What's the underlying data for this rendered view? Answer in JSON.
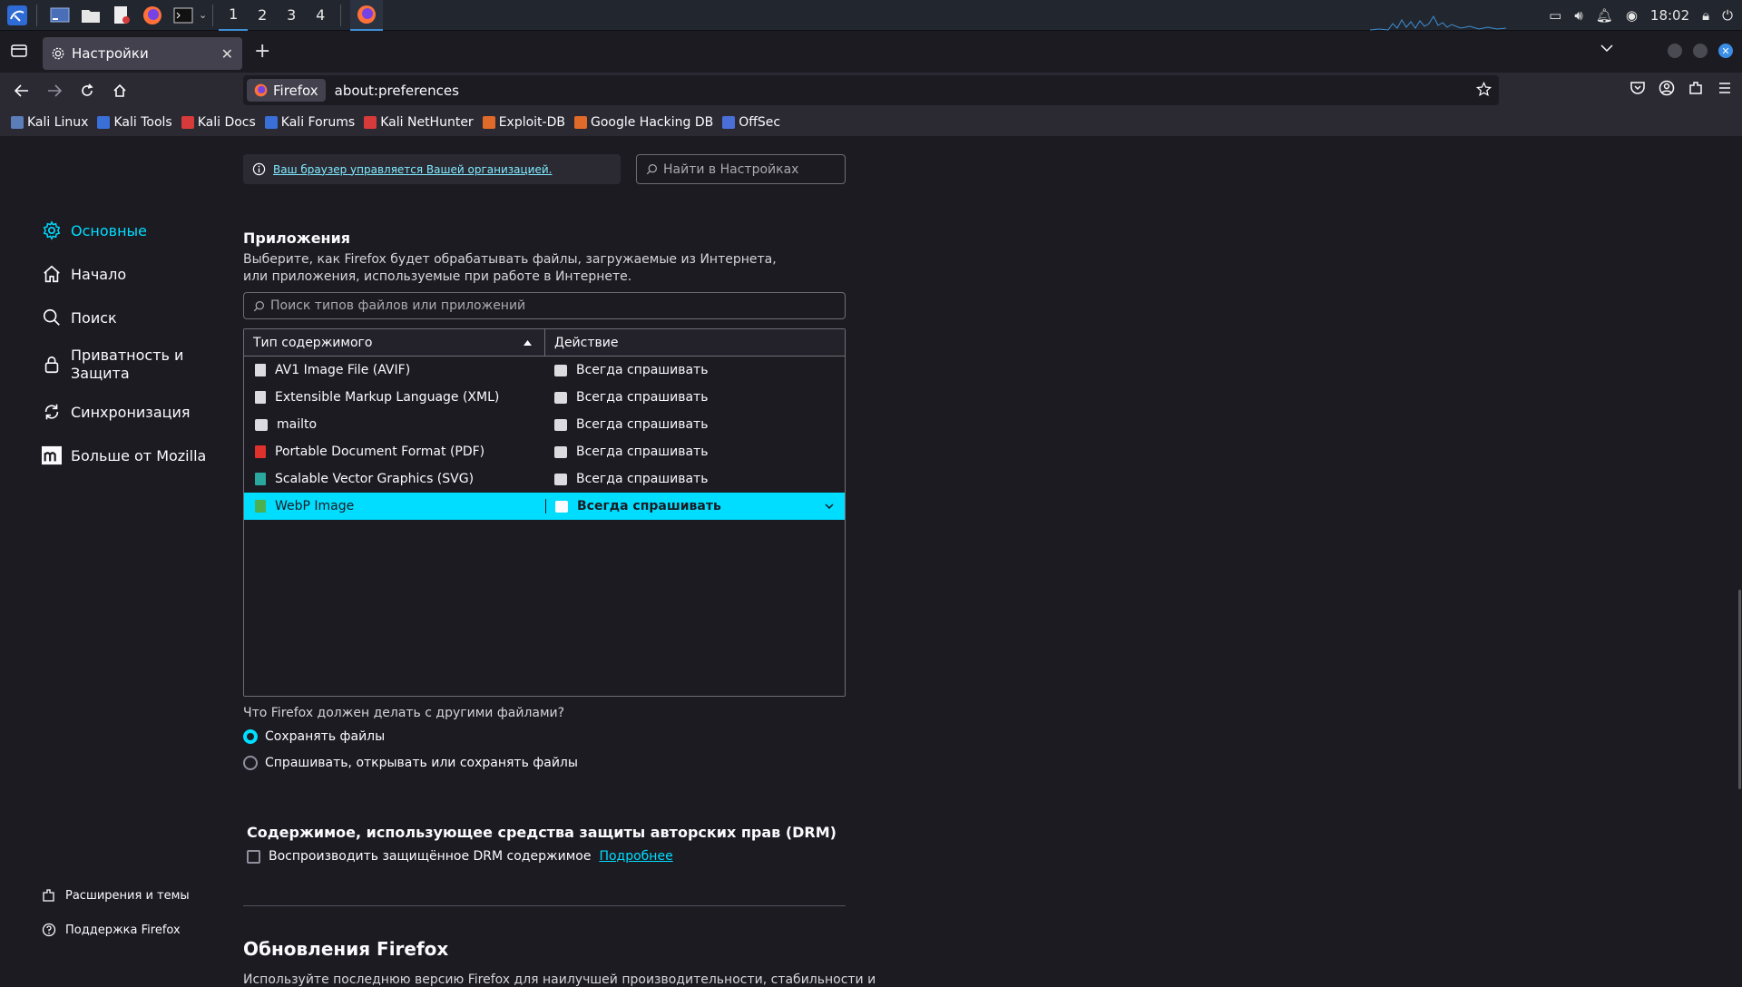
{
  "taskbar": {
    "workspaces": [
      "1",
      "2",
      "3",
      "4"
    ],
    "clock": "18:02"
  },
  "tab": {
    "title": "Настройки"
  },
  "navbar": {
    "identity": "Firefox",
    "url": "about:preferences"
  },
  "bookmarks": [
    {
      "label": "Kali Linux",
      "color": "#5b7db8"
    },
    {
      "label": "Kali Tools",
      "color": "#3a6fd8"
    },
    {
      "label": "Kali Docs",
      "color": "#d63a3a"
    },
    {
      "label": "Kali Forums",
      "color": "#3a6fd8"
    },
    {
      "label": "Kali NetHunter",
      "color": "#d63a3a"
    },
    {
      "label": "Exploit-DB",
      "color": "#e06a2a"
    },
    {
      "label": "Google Hacking DB",
      "color": "#e06a2a"
    },
    {
      "label": "OffSec",
      "color": "#4a6fd8"
    }
  ],
  "content": {
    "managed_notice": "Ваш браузер управляется Вашей организацией.",
    "search_placeholder": "Найти в Настройках"
  },
  "sidebar": {
    "categories": [
      {
        "label": "Основные",
        "icon": "gear-icon"
      },
      {
        "label": "Начало",
        "icon": "home-icon"
      },
      {
        "label": "Поиск",
        "icon": "search-icon"
      },
      {
        "label_line1": "Приватность и",
        "label_line2": "Защита",
        "icon": "lock-icon"
      },
      {
        "label": "Синхронизация",
        "icon": "sync-icon"
      },
      {
        "label": "Больше от Mozilla",
        "icon": "mozilla-icon"
      }
    ],
    "footer": [
      {
        "label": "Расширения и темы",
        "icon": "puzzle-icon"
      },
      {
        "label": "Поддержка Firefox",
        "icon": "help-icon"
      }
    ]
  },
  "applications": {
    "title": "Приложения",
    "description": "Выберите, как Firefox будет обрабатывать файлы, загружаемые из Интернета, или приложения, используемые при работе в Интернете.",
    "search_placeholder": "Поиск типов файлов или приложений",
    "col_type": "Тип содержимого",
    "col_action": "Действие",
    "rows": [
      {
        "type": "AV1 Image File (AVIF)",
        "action": "Всегда спрашивать",
        "icon_color": "#dcdce0"
      },
      {
        "type": "Extensible Markup Language (XML)",
        "action": "Всегда спрашивать",
        "icon_color": "#dcdce0"
      },
      {
        "type": "mailto",
        "action": "Всегда спрашивать",
        "icon_color": "#dcdce0"
      },
      {
        "type": "Portable Document Format (PDF)",
        "action": "Всегда спрашивать",
        "icon_color": "#e0312c"
      },
      {
        "type": "Scalable Vector Graphics (SVG)",
        "action": "Всегда спрашивать",
        "icon_color": "#2aa8a0"
      },
      {
        "type": "WebP Image",
        "action": "Всегда спрашивать",
        "icon_color": "#4caf50"
      }
    ],
    "other_files_question": "Что Firefox должен делать с другими файлами?",
    "radio_save": "Сохранять файлы",
    "radio_ask": "Спрашивать, открывать или сохранять файлы"
  },
  "drm": {
    "title": "Содержимое, использующее средства защиты авторских прав (DRM)",
    "checkbox_label": "Воспроизводить защищённое DRM содержимое",
    "learn_more": "Подробнее"
  },
  "updates": {
    "title": "Обновления Firefox",
    "description": "Используйте последнюю версию Firefox для наилучшей производительности, стабильности и"
  }
}
